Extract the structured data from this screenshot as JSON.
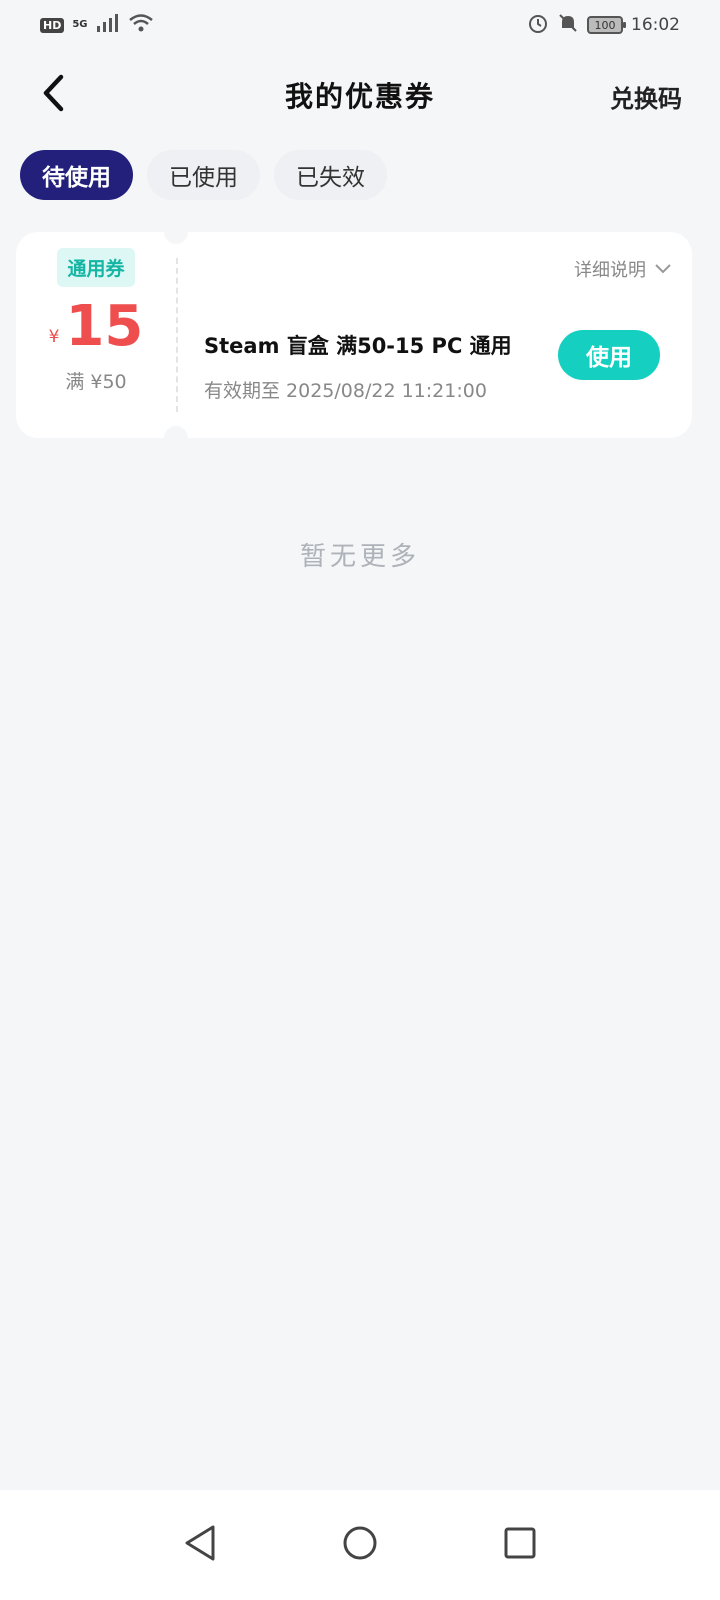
{
  "status_bar": {
    "hd": "HD",
    "network": "5G",
    "battery": "100",
    "time": "16:02"
  },
  "header": {
    "title": "我的优惠券",
    "redeem_label": "兑换码"
  },
  "tabs": [
    {
      "label": "待使用",
      "active": true
    },
    {
      "label": "已使用",
      "active": false
    },
    {
      "label": "已失效",
      "active": false
    }
  ],
  "coupon": {
    "tag": "通用券",
    "currency": "¥",
    "amount": "15",
    "threshold": "满 ¥50",
    "detail_label": "详细说明",
    "name": "Steam 盲盒 满50-15 PC 通用",
    "expiry": "有效期至 2025/08/22 11:21:00",
    "use_label": "使用"
  },
  "list_footer": "暂无更多",
  "colors": {
    "active_tab": "#22207a",
    "accent": "#15cfc0",
    "price": "#ef4e4e"
  }
}
